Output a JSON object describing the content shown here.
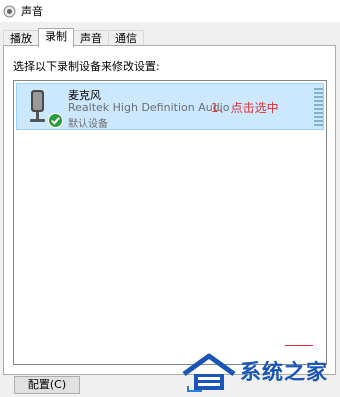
{
  "window": {
    "title": "声音"
  },
  "tabs": [
    {
      "label": "播放",
      "active": false
    },
    {
      "label": "录制",
      "active": true
    },
    {
      "label": "声音",
      "active": false
    },
    {
      "label": "通信",
      "active": false
    }
  ],
  "panel": {
    "instruction": "选择以下录制设备来修改设置:"
  },
  "device": {
    "name": "麦克风",
    "description": "Realtek High Definition Audio",
    "status": "默认设备",
    "icon": "microphone-icon",
    "default_badge_icon": "checkmark-icon"
  },
  "annotation": {
    "text": "1、点击选中",
    "color": "#e03030"
  },
  "buttons": {
    "configure": "配置(C)"
  },
  "watermark": {
    "text": "系统之家"
  },
  "colors": {
    "selection_bg": "#cce8ff",
    "selection_border": "#99d1ff",
    "accent": "#1a56b8"
  }
}
